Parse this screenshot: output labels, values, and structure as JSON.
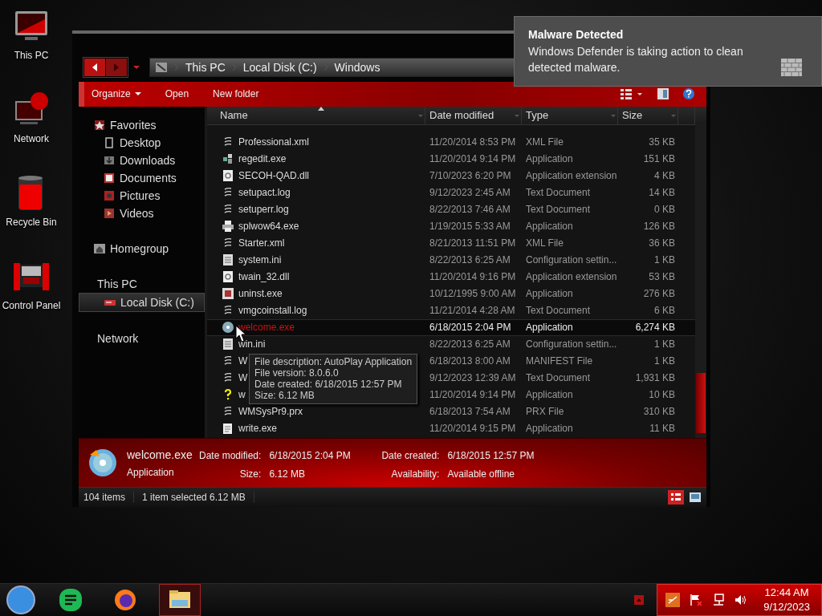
{
  "desktop_icons": [
    {
      "label": "This PC",
      "kind": "computer"
    },
    {
      "label": "Network",
      "kind": "network"
    },
    {
      "label": "Recycle Bin",
      "kind": "bin"
    },
    {
      "label": "Control Panel",
      "kind": "panel"
    }
  ],
  "window": {
    "address": {
      "path": [
        "This PC",
        "Local Disk (C:)",
        "Windows"
      ]
    },
    "toolbar": [
      {
        "label": "Organize",
        "has_menu": true
      },
      {
        "label": "Open",
        "has_menu": false
      },
      {
        "label": "New folder",
        "has_menu": false
      }
    ],
    "sidebar": [
      {
        "label": "Favorites",
        "kind": "star",
        "selected": false,
        "children": [
          {
            "label": "Desktop",
            "kind": "desktop",
            "selected": false
          },
          {
            "label": "Downloads",
            "kind": "download",
            "selected": false
          },
          {
            "label": "Documents",
            "kind": "doc",
            "selected": false
          },
          {
            "label": "Pictures",
            "kind": "picture",
            "selected": false
          },
          {
            "label": "Videos",
            "kind": "video",
            "selected": false
          }
        ]
      },
      {
        "label": "Homegroup",
        "kind": "home",
        "selected": false
      },
      {
        "label": "This PC",
        "kind": "computer",
        "selected": false,
        "children": [
          {
            "label": "Local Disk (C:)",
            "kind": "disk",
            "selected": true
          }
        ]
      },
      {
        "label": "Network",
        "kind": "network",
        "selected": false
      }
    ],
    "columns": [
      {
        "label": "Name",
        "sorted": true
      },
      {
        "label": "Date modified",
        "sorted": false
      },
      {
        "label": "Type",
        "sorted": false
      },
      {
        "label": "Size",
        "sorted": false
      }
    ],
    "rows": [
      {
        "name": "Professional.xml",
        "date": "11/20/2014 8:53 PM",
        "type": "XML File",
        "size": "35 KB",
        "kind": "text",
        "selected": false
      },
      {
        "name": "regedit.exe",
        "date": "11/20/2014 9:14 PM",
        "type": "Application",
        "size": "151 KB",
        "kind": "registry",
        "selected": false
      },
      {
        "name": "SECOH-QAD.dll",
        "date": "7/10/2023 6:20 PM",
        "type": "Application extension",
        "size": "4 KB",
        "kind": "extension",
        "selected": false
      },
      {
        "name": "setupact.log",
        "date": "9/12/2023 2:45 AM",
        "type": "Text Document",
        "size": "14 KB",
        "kind": "text",
        "selected": false
      },
      {
        "name": "setuperr.log",
        "date": "8/22/2013 7:46 AM",
        "type": "Text Document",
        "size": "0 KB",
        "kind": "text",
        "selected": false
      },
      {
        "name": "splwow64.exe",
        "date": "1/19/2015 5:33 AM",
        "type": "Application",
        "size": "126 KB",
        "kind": "printer",
        "selected": false
      },
      {
        "name": "Starter.xml",
        "date": "8/21/2013 11:51 PM",
        "type": "XML File",
        "size": "36 KB",
        "kind": "text",
        "selected": false
      },
      {
        "name": "system.ini",
        "date": "8/22/2013 6:25 AM",
        "type": "Configuration settin...",
        "size": "1 KB",
        "kind": "settings",
        "selected": false
      },
      {
        "name": "twain_32.dll",
        "date": "11/20/2014 9:16 PM",
        "type": "Application extension",
        "size": "53 KB",
        "kind": "extension",
        "selected": false
      },
      {
        "name": "uninst.exe",
        "date": "10/12/1995 9:00 AM",
        "type": "Application",
        "size": "276 KB",
        "kind": "installer",
        "selected": false
      },
      {
        "name": "vmgcoinstall.log",
        "date": "11/21/2014 4:28 AM",
        "type": "Text Document",
        "size": "6 KB",
        "kind": "text",
        "selected": false
      },
      {
        "name": "welcome.exe",
        "date": "6/18/2015 2:04 PM",
        "type": "Application",
        "size": "6,274 KB",
        "kind": "disc",
        "selected": true
      },
      {
        "name": "win.ini",
        "date": "8/22/2013 6:25 AM",
        "type": "Configuration settin...",
        "size": "1 KB",
        "kind": "settings",
        "selected": false
      },
      {
        "name": "W",
        "date": "6/18/2013 8:00 AM",
        "type": "MANIFEST File",
        "size": "1 KB",
        "kind": "text",
        "selected": false
      },
      {
        "name": "W",
        "date": "9/12/2023 12:39 AM",
        "type": "Text Document",
        "size": "1,931 KB",
        "kind": "text",
        "selected": false
      },
      {
        "name": "w",
        "date": "11/20/2014 9:14 PM",
        "type": "Application",
        "size": "10 KB",
        "kind": "help",
        "selected": false
      },
      {
        "name": "WMSysPr9.prx",
        "date": "6/18/2013 7:54 AM",
        "type": "PRX File",
        "size": "310 KB",
        "kind": "text",
        "selected": false
      },
      {
        "name": "write.exe",
        "date": "11/20/2014 9:15 PM",
        "type": "Application",
        "size": "11 KB",
        "kind": "write",
        "selected": false
      }
    ],
    "tooltip": [
      "File description: AutoPlay Application",
      "File version: 8.0.6.0",
      "Date created: 6/18/2015 12:57 PM",
      "Size: 6.12 MB"
    ],
    "details": {
      "name": "welcome.exe",
      "type": "Application",
      "fields": [
        {
          "label": "Date modified:",
          "value": "6/18/2015 2:04 PM"
        },
        {
          "label": "Date created:",
          "value": "6/18/2015 12:57 PM"
        },
        {
          "label": "Size:",
          "value": "6.12 MB"
        },
        {
          "label": "Availability:",
          "value": "Available offline"
        }
      ]
    },
    "status_bar": {
      "count": "104 items",
      "selection": "1 item selected  6.12 MB"
    }
  },
  "notification": {
    "title": "Malware Detected",
    "body": "Windows Defender is taking action to clean detected malware."
  },
  "taskbar": {
    "apps": [
      {
        "kind": "chat",
        "selected": false
      },
      {
        "kind": "browser",
        "selected": false
      },
      {
        "kind": "explorer",
        "selected": true
      }
    ],
    "time": "12:44 AM",
    "date": "9/12/2023"
  }
}
